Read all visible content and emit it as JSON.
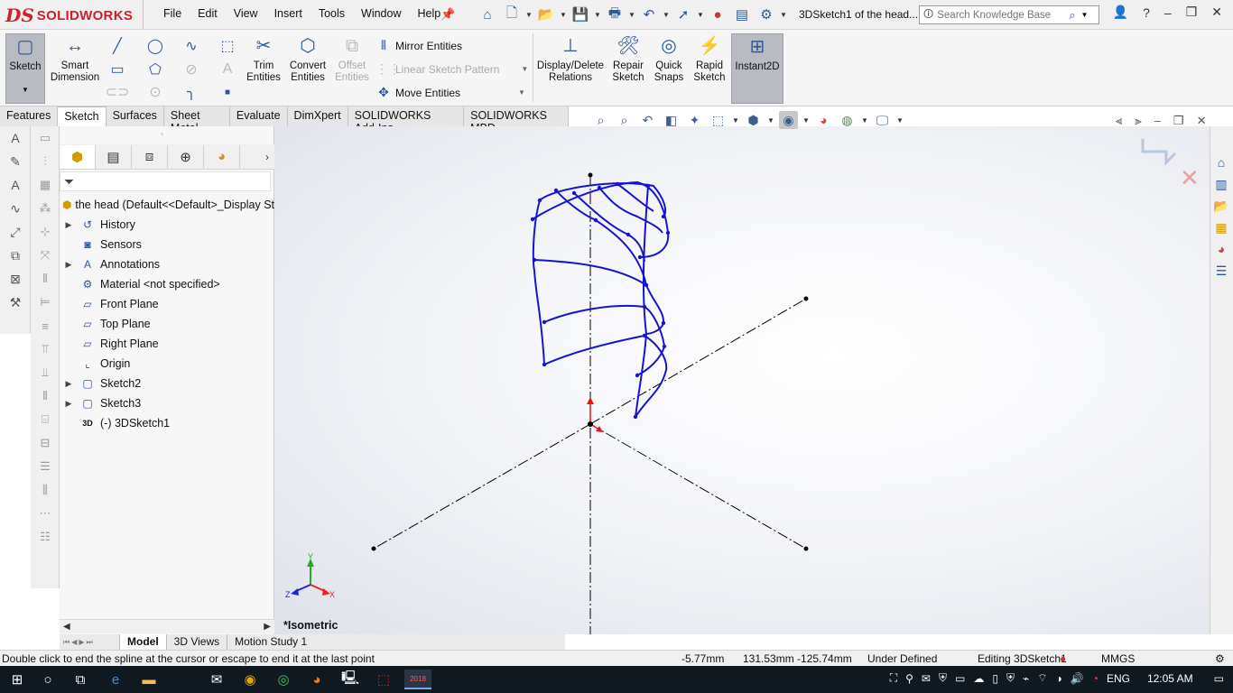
{
  "app": {
    "logo_prefix": "DS",
    "logo_name": "SOLIDWORKS",
    "document_title": "3DSketch1 of the head..."
  },
  "menu": [
    "File",
    "Edit",
    "View",
    "Insert",
    "Tools",
    "Window",
    "Help"
  ],
  "search": {
    "placeholder": "Search Knowledge Base"
  },
  "command_manager": {
    "sketch": "Sketch",
    "smart_dimension": "Smart\nDimension",
    "trim_entities": "Trim\nEntities",
    "convert_entities": "Convert\nEntities",
    "offset_entities": "Offset\nEntities",
    "mirror_entities": "Mirror Entities",
    "linear_sketch_pattern": "Linear Sketch Pattern",
    "move_entities": "Move Entities",
    "display_delete_relations": "Display/Delete\nRelations",
    "repair_sketch": "Repair\nSketch",
    "quick_snaps": "Quick\nSnaps",
    "rapid_sketch": "Rapid\nSketch",
    "instant2d": "Instant2D"
  },
  "tabs": [
    "Features",
    "Sketch",
    "Surfaces",
    "Sheet Metal",
    "Evaluate",
    "DimXpert",
    "SOLIDWORKS Add-Ins",
    "SOLIDWORKS MBD"
  ],
  "active_tab": "Sketch",
  "feature_tree": {
    "root": "the head  (Default<<Default>_Display St",
    "items": [
      {
        "label": "History",
        "icon": "history-icon",
        "expandable": true
      },
      {
        "label": "Sensors",
        "icon": "sensors-icon",
        "expandable": false
      },
      {
        "label": "Annotations",
        "icon": "annotations-icon",
        "expandable": true
      },
      {
        "label": "Material <not specified>",
        "icon": "material-icon",
        "expandable": false
      },
      {
        "label": "Front Plane",
        "icon": "plane-icon",
        "expandable": false
      },
      {
        "label": "Top Plane",
        "icon": "plane-icon",
        "expandable": false
      },
      {
        "label": "Right Plane",
        "icon": "plane-icon",
        "expandable": false
      },
      {
        "label": "Origin",
        "icon": "origin-icon",
        "expandable": false
      },
      {
        "label": "Sketch2",
        "icon": "sketch-icon",
        "expandable": true
      },
      {
        "label": "Sketch3",
        "icon": "sketch-icon",
        "expandable": true
      },
      {
        "label": "(-) 3DSketch1",
        "icon": "3dsketch-icon",
        "expandable": false
      }
    ]
  },
  "bottom_tabs": [
    "Model",
    "3D Views",
    "Motion Study 1"
  ],
  "active_bottom_tab": "Model",
  "viewport": {
    "view_name": "*Isometric",
    "axis_labels": {
      "x": "X",
      "y": "Y",
      "z": "Z"
    }
  },
  "status": {
    "message": "Double click to end the spline at the cursor or escape to end it at the last point",
    "coord1": "-5.77mm",
    "coord2": "131.53mm -125.74mm",
    "state": "Under Defined",
    "editing": "Editing 3DSketch1",
    "units": "MMGS"
  },
  "taskbar": {
    "language": "ENG",
    "time": "12:05 AM",
    "solidworks_year": "2018"
  },
  "colors": {
    "brand_red": "#d01e2a",
    "sketch_blue": "#1515d0",
    "toolbar_blue": "#2b579a"
  }
}
